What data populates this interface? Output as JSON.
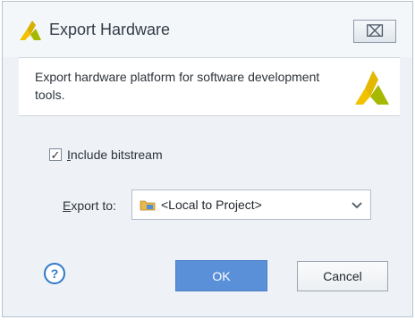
{
  "window": {
    "title": "Export Hardware",
    "close_glyph": "⌧"
  },
  "header": {
    "description": "Export hardware platform for software development tools."
  },
  "options": {
    "include_bitstream_checked": true,
    "include_bitstream_check_glyph": "✓",
    "include_bitstream_mnemonic": "I",
    "include_bitstream_rest": "nclude bitstream",
    "export_to_mnemonic": "E",
    "export_to_rest": "xport to:",
    "export_to_value": "<Local to Project>",
    "export_to_icon": "folder-icon"
  },
  "buttons": {
    "help_glyph": "?",
    "ok": "OK",
    "cancel": "Cancel"
  },
  "colors": {
    "accent": "#5a90d8",
    "help": "#2f78c8",
    "logo_yellow": "#f2c200",
    "logo_green": "#a6b800"
  }
}
